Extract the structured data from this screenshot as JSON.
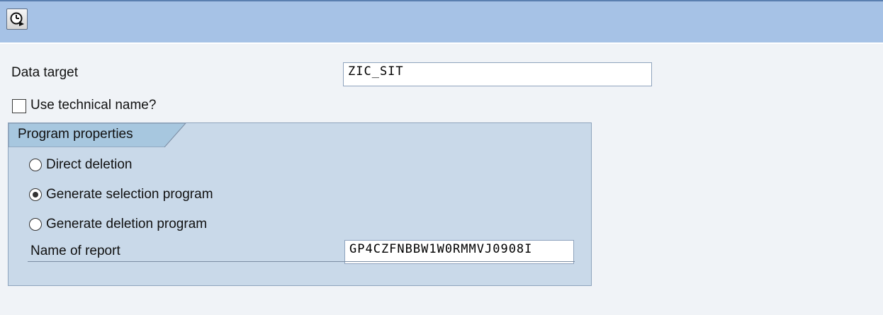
{
  "toolbar": {
    "execute_icon": "execute-clock-icon"
  },
  "form": {
    "data_target": {
      "label": "Data target",
      "value": "ZIC_SIT"
    },
    "use_technical_name": {
      "label": "Use technical name?",
      "checked": false
    }
  },
  "program_properties": {
    "title": "Program properties",
    "options": [
      {
        "label": "Direct deletion",
        "selected": false
      },
      {
        "label": "Generate selection program",
        "selected": true
      },
      {
        "label": "Generate deletion program",
        "selected": false
      }
    ],
    "report_name": {
      "label": "Name of report",
      "value": "GP4CZFNBBW1W0RMMVJ0908I"
    }
  },
  "colors": {
    "toolbar_bg": "#a6c2e6",
    "group_bg": "#c9d9e9",
    "page_bg": "#f0f3f7"
  }
}
